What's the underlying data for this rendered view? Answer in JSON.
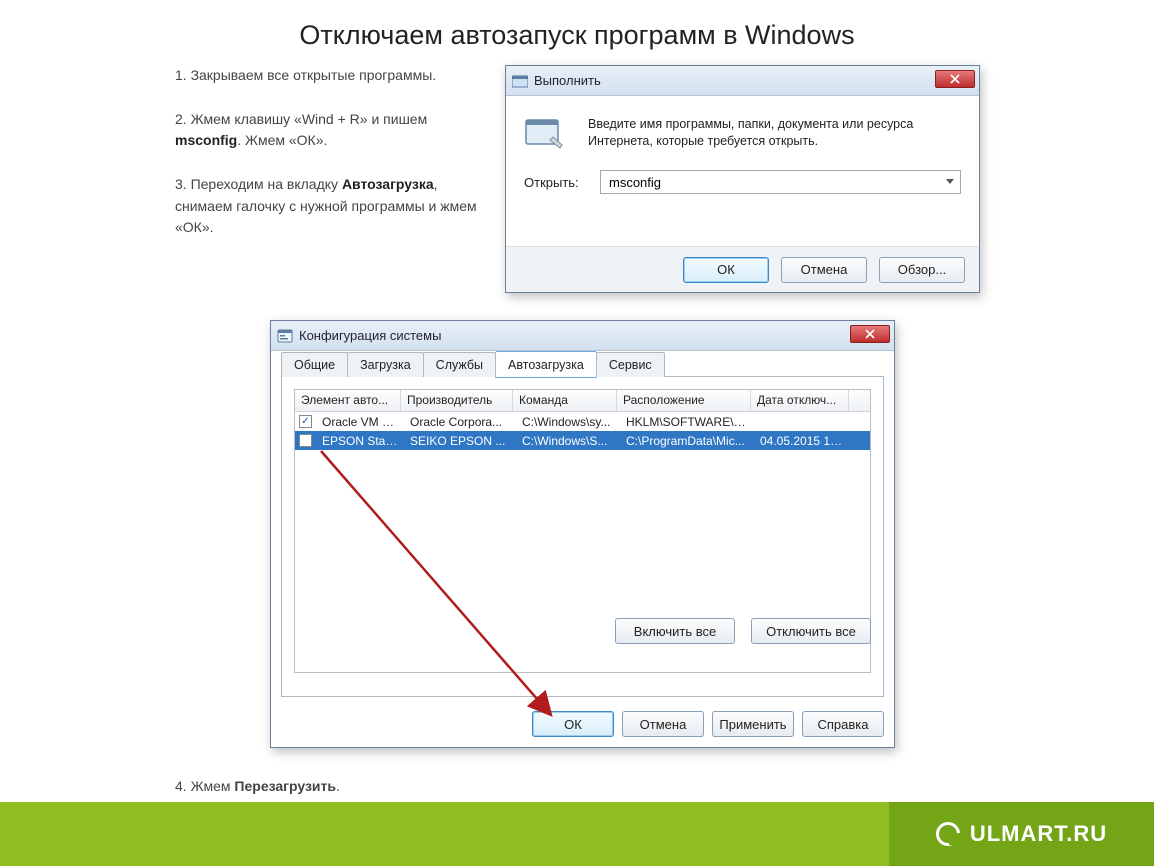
{
  "title": "Отключаем автозапуск программ в Windows",
  "steps": {
    "s1": "1. Закрываем все открытые программы.",
    "s2_a": "2. Жмем клавишу «Wind + R» и пишем ",
    "s2_b": "msconfig",
    "s2_c": ". Жмем «ОК».",
    "s3_a": "3. Переходим на вкладку ",
    "s3_b": "Автозагрузка",
    "s3_c": ", снимаем галочку с нужной программы и жмем «ОК».",
    "s4_a": "4. Жмем ",
    "s4_b": "Перезагрузить",
    "s4_c": "."
  },
  "run_dialog": {
    "title": "Выполнить",
    "description": "Введите имя программы, папки, документа или ресурса Интернета, которые требуется открыть.",
    "open_label": "Открыть:",
    "input_value": "msconfig",
    "ok": "ОК",
    "cancel": "Отмена",
    "browse": "Обзор..."
  },
  "msconfig": {
    "title": "Конфигурация системы",
    "tabs": [
      "Общие",
      "Загрузка",
      "Службы",
      "Автозагрузка",
      "Сервис"
    ],
    "columns": [
      "Элемент авто...",
      "Производитель",
      "Команда",
      "Расположение",
      "Дата отключ..."
    ],
    "rows": [
      {
        "checked": true,
        "cells": [
          "Oracle VM Vi...",
          "Oracle Corpora...",
          "C:\\Windows\\sy...",
          "HKLM\\SOFTWARE\\M...",
          ""
        ]
      },
      {
        "checked": false,
        "selected": true,
        "cells": [
          "EPSON Stat...",
          "SEIKO EPSON ...",
          "C:\\Windows\\S...",
          "C:\\ProgramData\\Mic...",
          "04.05.2015 19..."
        ]
      }
    ],
    "enable_all": "Включить все",
    "disable_all": "Отключить все",
    "ok": "ОК",
    "cancel": "Отмена",
    "apply": "Применить",
    "help": "Справка"
  },
  "footer": {
    "brand": "ULMART.RU"
  }
}
